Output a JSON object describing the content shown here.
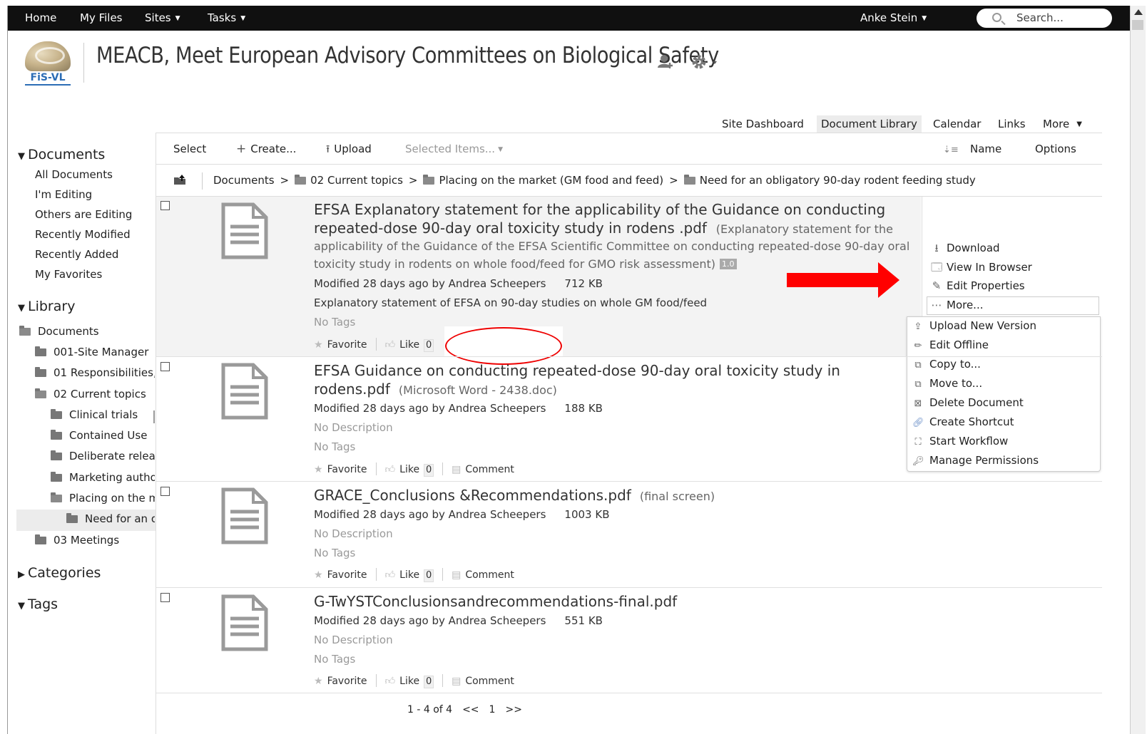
{
  "topbar": {
    "home": "Home",
    "my_files": "My Files",
    "sites": "Sites",
    "tasks": "Tasks",
    "user": "Anke Stein",
    "search_placeholder": "Search..."
  },
  "header": {
    "logo_text": "FiS-VL",
    "site_title": "MEACB, Meet European Advisory Committees on Biological Safety"
  },
  "site_nav": {
    "items": [
      "Site Dashboard",
      "Document Library",
      "Calendar",
      "Links",
      "More"
    ],
    "active": "Document Library"
  },
  "sidebar": {
    "documents_heading": "Documents",
    "document_filters": [
      "All Documents",
      "I'm Editing",
      "Others are Editing",
      "Recently Modified",
      "Recently Added",
      "My Favorites"
    ],
    "library_heading": "Library",
    "tree": {
      "root": "Documents",
      "site_manager": "001-Site Manager",
      "responsibilities": "01 Responsibilities,",
      "current_topics": "02 Current topics",
      "clinical_trials": "Clinical trials",
      "contained_use": "Contained Use",
      "deliberate": "Deliberate relea",
      "marketing": "Marketing autho",
      "placing": "Placing on the m",
      "need_for": "Need for an o",
      "meetings": "03 Meetings"
    },
    "categories_heading": "Categories",
    "tags_heading": "Tags"
  },
  "toolbar": {
    "select": "Select",
    "create": "Create...",
    "upload": "Upload",
    "selected_items": "Selected Items...",
    "sort_name": "Name",
    "options": "Options"
  },
  "breadcrumb": {
    "root": "Documents",
    "level1": "02 Current topics",
    "level2": "Placing on the market (GM food and feed)",
    "level3": "Need for an obligatory 90-day rodent feeding study"
  },
  "documents": [
    {
      "title_line1": "EFSA Explanatory statement for the applicability of the Guidance on conducting",
      "title_line2": "repeated-dose 90-day oral toxicity study in rodens .pdf",
      "subtitle_a": "(Explanatory statement for the",
      "subtitle_b": "applicability of the Guidance of the EFSA Scientific Committee on conducting repeated-dose 90-day oral",
      "subtitle_c": "toxicity study in rodents on whole food/feed for GMO risk assessment)",
      "version": "1.0",
      "modified": "Modified 28 days ago by Andrea Scheepers",
      "size": "712 KB",
      "description": "Explanatory statement of EFSA on 90-day studies on whole GM food/feed",
      "tags": "No Tags",
      "favorite": "Favorite",
      "like": "Like",
      "like_count": "0"
    },
    {
      "title_line1": "EFSA Guidance on conducting repeated-dose 90-day oral toxicity study in",
      "title_line2": "rodens.pdf",
      "subtitle": "(Microsoft Word - 2438.doc)",
      "modified": "Modified 28 days ago by Andrea Scheepers",
      "size": "188 KB",
      "description": "No Description",
      "tags": "No Tags",
      "favorite": "Favorite",
      "like": "Like",
      "like_count": "0",
      "comment": "Comment"
    },
    {
      "title": "GRACE_Conclusions &Recommendations.pdf",
      "subtitle": "(final screen)",
      "modified": "Modified 28 days ago by Andrea Scheepers",
      "size": "1003 KB",
      "description": "No Description",
      "tags": "No Tags",
      "favorite": "Favorite",
      "like": "Like",
      "like_count": "0",
      "comment": "Comment"
    },
    {
      "title": "G-TwYSTConclusionsandrecommendations-final.pdf",
      "modified": "Modified 28 days ago by Andrea Scheepers",
      "size": "551 KB",
      "description": "No Description",
      "tags": "No Tags",
      "favorite": "Favorite",
      "like": "Like",
      "like_count": "0",
      "comment": "Comment"
    }
  ],
  "row_actions": {
    "download": "Download",
    "view_in_browser": "View In Browser",
    "edit_properties": "Edit Properties",
    "more": "More..."
  },
  "more_menu": {
    "upload_new_version": "Upload New Version",
    "edit_offline": "Edit Offline",
    "copy_to": "Copy to...",
    "move_to": "Move to...",
    "delete_document": "Delete Document",
    "create_shortcut": "Create Shortcut",
    "start_workflow": "Start Workflow",
    "manage_permissions": "Manage Permissions"
  },
  "pager": {
    "range": "1 - 4 of 4",
    "prev": "<<",
    "page": "1",
    "next": ">>"
  },
  "colors": {
    "topbar_bg": "#101010",
    "annotation_red": "#ff0000",
    "selected_row_bg": "#f3f3f3"
  }
}
